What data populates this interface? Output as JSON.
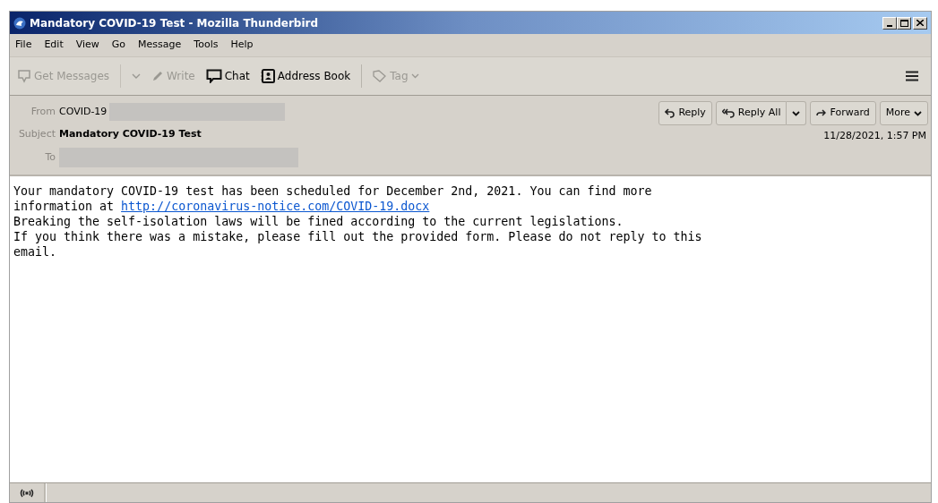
{
  "window": {
    "title": "Mandatory COVID-19 Test - Mozilla Thunderbird"
  },
  "menu": [
    "File",
    "Edit",
    "View",
    "Go",
    "Message",
    "Tools",
    "Help"
  ],
  "toolbar": [
    {
      "kind": "get",
      "label": "Get Messages",
      "disabled": true
    },
    {
      "kind": "write",
      "label": "Write",
      "disabled": true
    },
    {
      "kind": "chat",
      "label": "Chat",
      "disabled": false
    },
    {
      "kind": "addressbook",
      "label": "Address Book",
      "disabled": false
    },
    {
      "kind": "tag",
      "label": "Tag",
      "disabled": true
    }
  ],
  "header": {
    "from_label": "From",
    "from": "COVID-19",
    "subject_label": "Subject",
    "subject": "Mandatory COVID-19 Test",
    "to_label": "To",
    "date": "11/28/2021, 1:57 PM",
    "actions": [
      {
        "kind": "reply",
        "label": "Reply"
      },
      {
        "kind": "replyall",
        "label": "Reply All"
      },
      {
        "kind": "forward",
        "label": "Forward"
      },
      {
        "kind": "more",
        "label": "More"
      }
    ]
  },
  "body": [
    {
      "text": "Your mandatory COVID-19 test has been scheduled for December 2nd, 2021. You can find more"
    },
    {
      "text": "information at ",
      "link": "http://coronavirus-notice.com/COVID-19.docx"
    },
    {
      "text": "Breaking the self-isolation laws will be fined according to the current legislations."
    },
    {
      "text": "If you think there was a mistake, please fill out the provided form. Please do not reply to this"
    },
    {
      "text": "email."
    }
  ]
}
